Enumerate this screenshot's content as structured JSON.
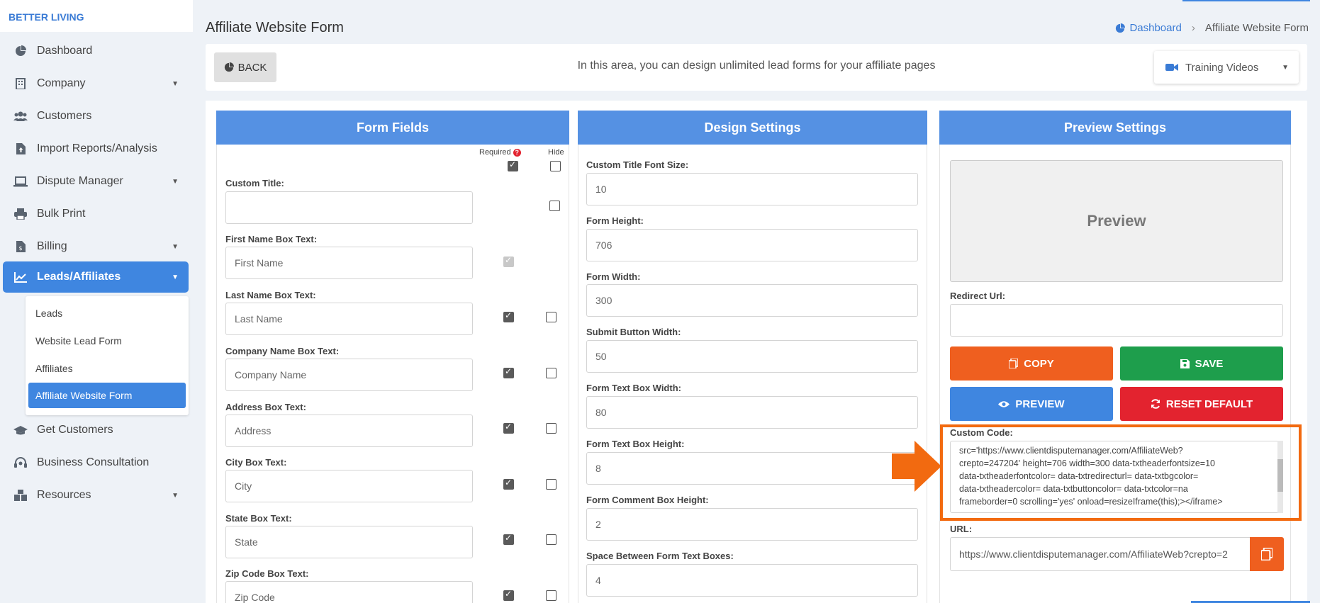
{
  "brand": "BETTER LIVING",
  "sidebar": {
    "items": [
      {
        "label": "Dashboard",
        "icon": "pie-chart-icon",
        "caret": false
      },
      {
        "label": "Company",
        "icon": "building-icon",
        "caret": true
      },
      {
        "label": "Customers",
        "icon": "users-icon",
        "caret": false
      },
      {
        "label": "Import Reports/Analysis",
        "icon": "file-upload-icon",
        "caret": false
      },
      {
        "label": "Dispute Manager",
        "icon": "laptop-icon",
        "caret": true
      },
      {
        "label": "Bulk Print",
        "icon": "printer-icon",
        "caret": false
      },
      {
        "label": "Billing",
        "icon": "invoice-icon",
        "caret": true
      },
      {
        "label": "Leads/Affiliates",
        "icon": "line-chart-icon",
        "caret": true
      },
      {
        "label": "Get Customers",
        "icon": "graduation-cap-icon",
        "caret": false
      },
      {
        "label": "Business Consultation",
        "icon": "headset-icon",
        "caret": false
      },
      {
        "label": "Resources",
        "icon": "boxes-icon",
        "caret": true
      }
    ],
    "submenu": [
      "Leads",
      "Website Lead Form",
      "Affiliates",
      "Affiliate Website Form"
    ]
  },
  "page_title": "Affiliate Website Form",
  "breadcrumb": {
    "home": "Dashboard",
    "current": "Affiliate Website Form"
  },
  "topbar": {
    "back": "BACK",
    "description": "In this area, you can design unlimited lead forms for your affiliate pages",
    "training": "Training Videos"
  },
  "form_fields": {
    "title": "Form Fields",
    "required_label": "Required",
    "hide_label": "Hide",
    "fields": [
      {
        "label": "Custom Title:",
        "value": "",
        "required": null,
        "hide": false
      },
      {
        "label": "First Name Box Text:",
        "value": "First Name",
        "required": true,
        "hide": null
      },
      {
        "label": "Last Name Box Text:",
        "value": "Last Name",
        "required": true,
        "hide": false
      },
      {
        "label": "Company Name Box Text:",
        "value": "Company Name",
        "required": true,
        "hide": false
      },
      {
        "label": "Address Box Text:",
        "value": "Address",
        "required": true,
        "hide": false
      },
      {
        "label": "City Box Text:",
        "value": "City",
        "required": true,
        "hide": false
      },
      {
        "label": "State Box Text:",
        "value": "State",
        "required": true,
        "hide": false
      },
      {
        "label": "Zip Code Box Text:",
        "value": "Zip Code",
        "required": true,
        "hide": false
      }
    ]
  },
  "design": {
    "title": "Design Settings",
    "fields": [
      {
        "label": "Custom Title Font Size:",
        "value": "10"
      },
      {
        "label": "Form Height:",
        "value": "706"
      },
      {
        "label": "Form Width:",
        "value": "300"
      },
      {
        "label": "Submit Button Width:",
        "value": "50"
      },
      {
        "label": "Form Text Box Width:",
        "value": "80"
      },
      {
        "label": "Form Text Box Height:",
        "value": "8"
      },
      {
        "label": "Form Comment Box Height:",
        "value": "2"
      },
      {
        "label": "Space Between Form Text Boxes:",
        "value": "4"
      }
    ]
  },
  "preview": {
    "title": "Preview Settings",
    "preview_text": "Preview",
    "redirect_label": "Redirect Url:",
    "redirect_value": "",
    "copy": "COPY",
    "save": "SAVE",
    "preview_btn": "PREVIEW",
    "reset": "RESET DEFAULT",
    "code_label": "Custom Code:",
    "code_lines": [
      "src='https://www.clientdisputemanager.com/AffiliateWeb?",
      "crepto=247204' height=706 width=300 data-txtheaderfontsize=10",
      "data-txtheaderfontcolor= data-txtredirecturl= data-txtbgcolor=",
      "data-txtheadercolor= data-txtbuttoncolor= data-txtcolor=na",
      "frameborder=0  scrolling='yes' onload=resizeIframe(this);></iframe>"
    ],
    "url_label": "URL:",
    "url_value": "https://www.clientdisputemanager.com/AffiliateWeb?crepto=2"
  },
  "colors": {
    "accent": "#3f86e0",
    "header": "#5591e3",
    "copy": "#ef5f1f",
    "save": "#1e9e4c",
    "preview": "#3f86e0",
    "reset": "#e3232f",
    "highlight": "#f26a10"
  }
}
